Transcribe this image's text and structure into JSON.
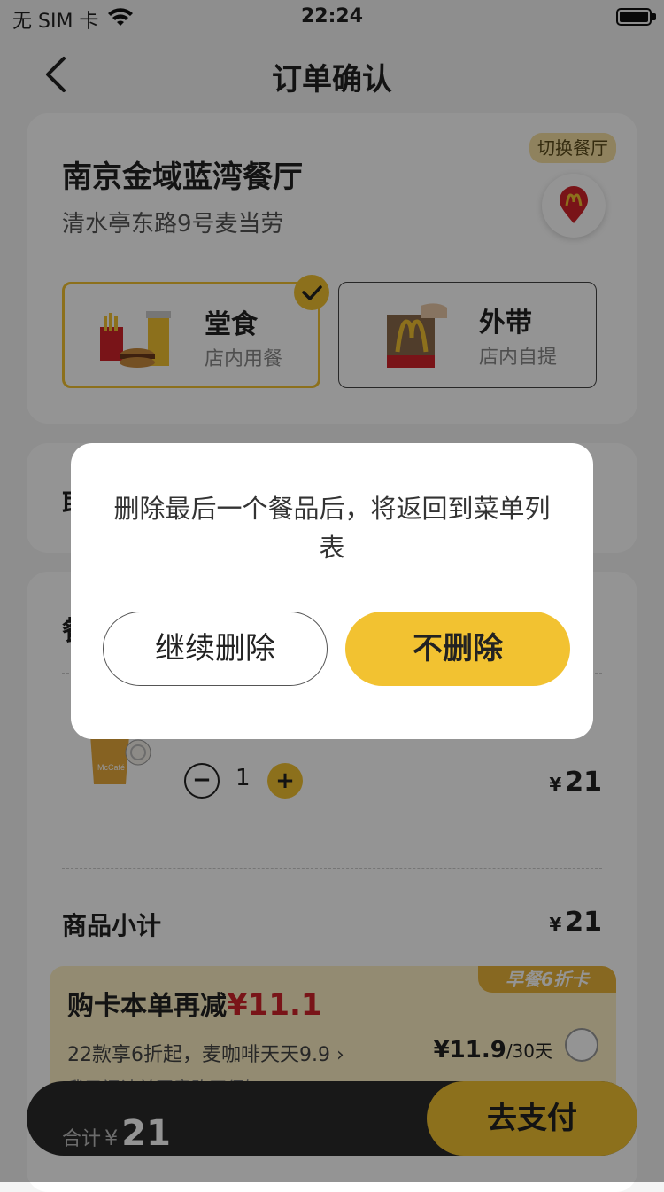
{
  "status_bar": {
    "carrier": "无 SIM 卡",
    "time": "22:24"
  },
  "nav": {
    "title": "订单确认"
  },
  "store": {
    "name": "南京金域蓝湾餐厅",
    "address": "清水亭东路9号麦当劳",
    "switch_label": "切换餐厅"
  },
  "dining_modes": [
    {
      "title": "堂食",
      "subtitle": "店内用餐",
      "selected": true
    },
    {
      "title": "外带",
      "subtitle": "店内自提",
      "selected": false
    }
  ],
  "pickup": {
    "label": "取"
  },
  "order": {
    "heading": "餐",
    "item": {
      "quantity": "1",
      "currency": "¥",
      "price": "21"
    },
    "subtotal": {
      "label": "商品小计",
      "currency": "¥",
      "value": "21"
    }
  },
  "promo": {
    "tag": "早餐6折卡",
    "title": "购卡本单再减",
    "amount": "¥11.1",
    "description": "22款享6折起，麦咖啡天天9.9 ›",
    "price": "¥11.9",
    "period": "/30天",
    "agreement": "我已阅读并同意购买须知"
  },
  "bottom_bar": {
    "total_label": "合计",
    "currency": "¥",
    "total": "21",
    "pay_label": "去支付"
  },
  "dialog": {
    "message": "删除最后一个餐品后，将返回到菜单列表",
    "continue_label": "继续删除",
    "keep_label": "不删除"
  },
  "colors": {
    "accent": "#f2c231",
    "promo_red": "#d0232a",
    "dark_bar": "#2a2a2a"
  }
}
